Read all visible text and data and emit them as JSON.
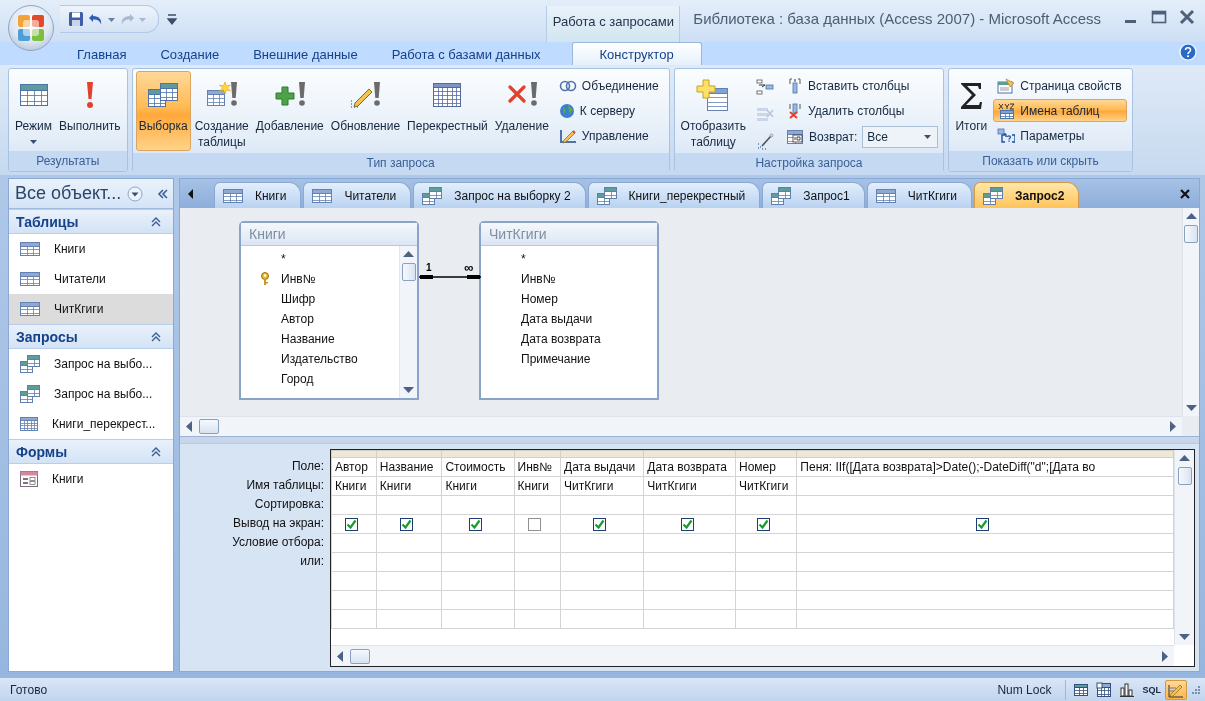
{
  "title_bar": {
    "context_label": "Работа с запросами",
    "title": "Библиотека : база данных (Access 2007) - Microsoft Access"
  },
  "ribbon_tabs": [
    {
      "label": "Главная",
      "selected": false
    },
    {
      "label": "Создание",
      "selected": false
    },
    {
      "label": "Внешние данные",
      "selected": false
    },
    {
      "label": "Работа с базами данных",
      "selected": false
    },
    {
      "label": "Конструктор",
      "selected": true
    }
  ],
  "ribbon_groups": [
    {
      "title": "Результаты",
      "items": [
        {
          "kind": "large",
          "label": "Режим",
          "dropdown": true,
          "selected": false
        },
        {
          "kind": "large",
          "label": "Выполнить",
          "selected": false
        }
      ]
    },
    {
      "title": "Тип запроса",
      "items": [
        {
          "kind": "large",
          "label": "Выборка",
          "selected": true
        },
        {
          "kind": "large",
          "label": "Создание\nтаблицы",
          "selected": false
        },
        {
          "kind": "large",
          "label": "Добавление",
          "selected": false
        },
        {
          "kind": "large",
          "label": "Обновление",
          "selected": false
        },
        {
          "kind": "large",
          "label": "Перекрестный",
          "selected": false
        },
        {
          "kind": "large",
          "label": "Удаление",
          "selected": false
        },
        {
          "kind": "small",
          "label": "Объединение",
          "selected": false
        },
        {
          "kind": "small",
          "label": "К серверу",
          "selected": false
        },
        {
          "kind": "small",
          "label": "Управление",
          "selected": false
        }
      ]
    },
    {
      "title": "Настройка запроса",
      "items": [
        {
          "kind": "large",
          "label": "Отобразить\nтаблицу",
          "selected": false
        },
        {
          "kind": "icon"
        },
        {
          "kind": "icon"
        },
        {
          "kind": "icon"
        },
        {
          "kind": "small",
          "label": "Вставить столбцы",
          "selected": false
        },
        {
          "kind": "small",
          "label": "Удалить столбцы",
          "selected": false
        },
        {
          "kind": "combo",
          "label": "Возврат:",
          "value": "Все"
        }
      ]
    },
    {
      "title": "Показать или скрыть",
      "items": [
        {
          "kind": "large",
          "label": "Итоги",
          "selected": false
        },
        {
          "kind": "small",
          "label": "Страница свойств",
          "selected": false
        },
        {
          "kind": "small",
          "label": "Имена таблиц",
          "selected": true
        },
        {
          "kind": "small",
          "label": "Параметры",
          "selected": false
        }
      ]
    }
  ],
  "nav_pane": {
    "title": "Все объект...",
    "groups": [
      {
        "title": "Таблицы",
        "items": [
          {
            "label": "Книги",
            "kind": "table",
            "selected": false
          },
          {
            "label": "Читатели",
            "kind": "table",
            "selected": false
          },
          {
            "label": "ЧитКгиги",
            "kind": "table",
            "selected": true
          }
        ]
      },
      {
        "title": "Запросы",
        "items": [
          {
            "label": "Запрос на выбо...",
            "kind": "query",
            "selected": false
          },
          {
            "label": "Запрос на выбо...",
            "kind": "query",
            "selected": false
          },
          {
            "label": "Книги_перекрест...",
            "kind": "crosstab",
            "selected": false
          }
        ]
      },
      {
        "title": "Формы",
        "items": [
          {
            "label": "Книги",
            "kind": "form",
            "selected": false
          }
        ]
      }
    ]
  },
  "document_tabs": [
    {
      "label": "Книги",
      "kind": "table",
      "selected": false
    },
    {
      "label": "Читатели",
      "kind": "table",
      "selected": false
    },
    {
      "label": "Запрос на выборку 2",
      "kind": "query",
      "selected": false
    },
    {
      "label": "Книги_перекрестный",
      "kind": "query",
      "selected": false
    },
    {
      "label": "Запрос1",
      "kind": "query",
      "selected": false
    },
    {
      "label": "ЧитКгиги",
      "kind": "table",
      "selected": false
    },
    {
      "label": "Запрос2",
      "kind": "query",
      "selected": true
    }
  ],
  "field_lists": [
    {
      "name": "Книги",
      "fields": [
        {
          "name": "*",
          "key": false
        },
        {
          "name": "Инв№",
          "key": true
        },
        {
          "name": "Шифр",
          "key": false
        },
        {
          "name": "Автор",
          "key": false
        },
        {
          "name": "Название",
          "key": false
        },
        {
          "name": "Издательство",
          "key": false
        },
        {
          "name": "Город",
          "key": false
        }
      ]
    },
    {
      "name": "ЧитКгиги",
      "fields": [
        {
          "name": "*",
          "key": false
        },
        {
          "name": "Инв№",
          "key": false
        },
        {
          "name": "Номер",
          "key": false
        },
        {
          "name": "Дата выдачи",
          "key": false
        },
        {
          "name": "Дата возврата",
          "key": false
        },
        {
          "name": "Примечание",
          "key": false
        }
      ]
    }
  ],
  "relationship": {
    "one": "1",
    "many": "∞"
  },
  "design_grid": {
    "row_labels": [
      "Поле:",
      "Имя таблицы:",
      "Сортировка:",
      "Вывод на экран:",
      "Условие отбора:",
      "или:"
    ],
    "columns": [
      {
        "field": "Автор",
        "table": "Книги",
        "show": true
      },
      {
        "field": "Название",
        "table": "Книги",
        "show": true
      },
      {
        "field": "Стоимость",
        "table": "Книги",
        "show": true
      },
      {
        "field": "Инв№",
        "table": "Книги",
        "show": false
      },
      {
        "field": "Дата выдачи",
        "table": "ЧитКгиги",
        "show": true
      },
      {
        "field": "Дата возврата",
        "table": "ЧитКгиги",
        "show": true
      },
      {
        "field": "Номер",
        "table": "ЧитКгиги",
        "show": true
      },
      {
        "field": "Пеня: IIf([Дата возврата]>Date();-DateDiff(\"d\";[Дата во",
        "show": true
      }
    ]
  },
  "status_bar": {
    "text": "Готово",
    "indicator": "Num Lock",
    "views": [
      {
        "kind": "datasheet",
        "selected": false
      },
      {
        "kind": "pivot-table",
        "selected": false
      },
      {
        "kind": "pivot-chart",
        "selected": false
      },
      {
        "kind": "sql",
        "label": "SQL",
        "selected": false
      },
      {
        "kind": "design",
        "selected": true
      }
    ]
  }
}
